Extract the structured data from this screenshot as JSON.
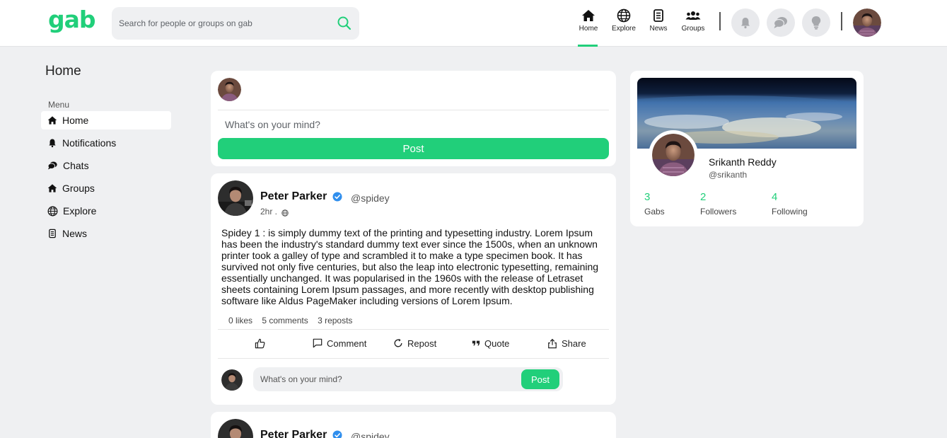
{
  "brand": {
    "logo_text": "gab",
    "accent": "#21cf7a"
  },
  "search": {
    "placeholder": "Search for people or groups on gab"
  },
  "topnav": {
    "items": [
      {
        "label": "Home",
        "icon": "home-icon",
        "active": true
      },
      {
        "label": "Explore",
        "icon": "globe-icon"
      },
      {
        "label": "News",
        "icon": "news-icon"
      },
      {
        "label": "Groups",
        "icon": "groups-icon"
      }
    ],
    "actions": [
      "bell-icon",
      "chat-icon",
      "lightbulb-icon"
    ]
  },
  "sidebar": {
    "page_title": "Home",
    "menu_label": "Menu",
    "items": [
      {
        "label": "Home",
        "icon": "home-icon",
        "active": true
      },
      {
        "label": "Notifications",
        "icon": "bell-icon"
      },
      {
        "label": "Chats",
        "icon": "chat-icon"
      },
      {
        "label": "Groups",
        "icon": "home-icon"
      },
      {
        "label": "Explore",
        "icon": "globe-icon"
      },
      {
        "label": "News",
        "icon": "news-icon"
      }
    ]
  },
  "composer": {
    "placeholder": "What's on your mind?",
    "post_label": "Post"
  },
  "posts": [
    {
      "author": "Peter Parker",
      "handle": "@spidey",
      "time": "2hr .",
      "body": "Spidey 1 : is simply dummy text of the printing and typesetting industry. Lorem Ipsum has been the industry's standard dummy text ever since the 1500s, when an unknown printer took a galley of type and scrambled it to make a type specimen book. It has survived not only five centuries, but also the leap into electronic typesetting, remaining essentially unchanged. It was popularised in the 1960s with the release of Letraset sheets containing Lorem Ipsum passages, and more recently with desktop publishing software like Aldus PageMaker including versions of Lorem Ipsum.",
      "likes": "0 likes",
      "comments": "5 comments",
      "reposts": "3 reposts",
      "actions": {
        "comment": "Comment",
        "repost": "Repost",
        "quote": "Quote",
        "share": "Share"
      },
      "reply_placeholder": "What's on your mind?",
      "reply_post_label": "Post"
    },
    {
      "author": "Peter Parker",
      "handle": "@spidey"
    }
  ],
  "profile": {
    "name": "Srikanth Reddy",
    "handle": "@srikanth",
    "stats": [
      {
        "value": "3",
        "label": "Gabs"
      },
      {
        "value": "2",
        "label": "Followers"
      },
      {
        "value": "4",
        "label": "Following"
      }
    ]
  }
}
